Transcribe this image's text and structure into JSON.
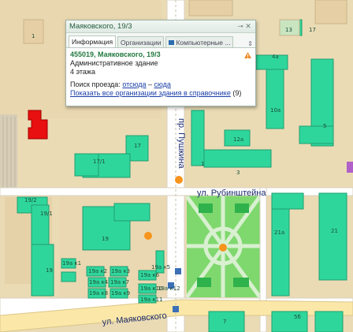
{
  "popup": {
    "title": "Маяковского, 19/3",
    "pin_icon": "pin-icon",
    "close_icon": "close-icon",
    "tabs": [
      "Информация",
      "Организации",
      "Компьютерные ..."
    ],
    "address": "455019, Маяковского, 19/3",
    "type": "Административное здание",
    "floors": "4 этажа",
    "route_label": "Поиск проезда:",
    "route_from": "отсюда",
    "route_dash": "–",
    "route_to": "сюда",
    "show_all": "Показать все организации здания в справочнике",
    "show_all_count": "(9)"
  },
  "streets": {
    "pushkina": "пр. Пушкина",
    "rubinshteina": "ул. Рубинштейна",
    "mayakovskogo": "ул. Маяковского"
  },
  "buildings": {
    "b1": "1",
    "b13": "13",
    "b17top": "17",
    "b4a": "4а",
    "b10a": "10а",
    "b5": "5",
    "b12a": "12а",
    "b3": "3",
    "b1s": "1",
    "b17": "17",
    "b171": "17/1",
    "b192": "19/2",
    "b191": "19/1",
    "b19": "19",
    "b19s": "19",
    "b21a": "21а",
    "b21": "21",
    "b5b": "5б",
    "b7": "7",
    "k1": "19а к1",
    "k2": "19а к2",
    "k3": "19а к3",
    "k4": "19а к4",
    "k5": "19а к5",
    "k6": "19а к6",
    "k7": "19а к7",
    "k8": "19а к8",
    "k9": "19а к9",
    "k10": "19а к10",
    "k11": "19а к11",
    "k12": "19а к12"
  },
  "colors": {
    "building": "#2fd69c",
    "land": "#eadbb5",
    "park": "#7fd86e",
    "selected": "#e81010",
    "road": "#ffffff"
  }
}
